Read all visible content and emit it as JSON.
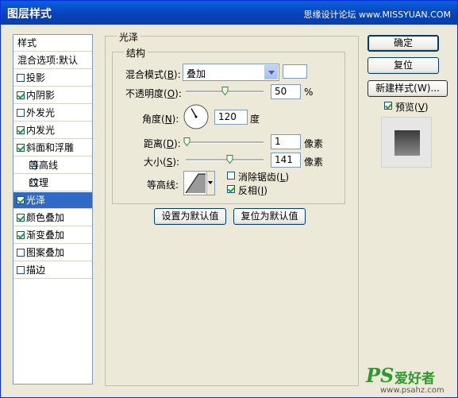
{
  "window": {
    "title": "图层样式",
    "watermark": "思缘设计论坛 www.MISSYUAN.COM"
  },
  "style_list": {
    "items": [
      {
        "label": "样式",
        "checkbox": false,
        "checked": false
      },
      {
        "label": "混合选项:默认",
        "checkbox": false,
        "checked": false
      },
      {
        "label": "投影",
        "checkbox": true,
        "checked": false
      },
      {
        "label": "内阴影",
        "checkbox": true,
        "checked": true
      },
      {
        "label": "外发光",
        "checkbox": true,
        "checked": false
      },
      {
        "label": "内发光",
        "checkbox": true,
        "checked": true
      },
      {
        "label": "斜面和浮雕",
        "checkbox": true,
        "checked": true
      },
      {
        "label": "等高线",
        "checkbox": true,
        "checked": false
      },
      {
        "label": "纹理",
        "checkbox": true,
        "checked": false
      },
      {
        "label": "光泽",
        "checkbox": true,
        "checked": true,
        "selected": true
      },
      {
        "label": "颜色叠加",
        "checkbox": true,
        "checked": true
      },
      {
        "label": "渐变叠加",
        "checkbox": true,
        "checked": true
      },
      {
        "label": "图案叠加",
        "checkbox": true,
        "checked": false
      },
      {
        "label": "描边",
        "checkbox": true,
        "checked": false
      }
    ]
  },
  "panel": {
    "group_title": "光泽",
    "sub_title": "结构",
    "blend_mode": {
      "label": "混合模式(",
      "key": "B",
      "suffix": "):",
      "value": "叠加"
    },
    "opacity": {
      "label": "不透明度(",
      "key": "O",
      "suffix": "):",
      "value": "50",
      "unit": "%",
      "level": 50
    },
    "angle": {
      "label": "角度(",
      "key": "N",
      "suffix": "):",
      "value": "120",
      "unit": "度"
    },
    "distance": {
      "label": "距离(",
      "key": "D",
      "suffix": "):",
      "value": "1",
      "unit": "像素",
      "level": 1
    },
    "size": {
      "label": "大小(",
      "key": "S",
      "suffix": "):",
      "value": "141",
      "unit": "像素",
      "level": 56
    },
    "contour": {
      "label": "等高线:"
    },
    "anti_alias": {
      "label_pre": "消除锯齿(",
      "key": "L",
      "suffix": ")",
      "checked": false
    },
    "invert": {
      "label_pre": "反相(",
      "key": "I",
      "suffix": ")",
      "checked": true
    },
    "make_default": "设置为默认值",
    "reset_default": "复位为默认值"
  },
  "buttons": {
    "ok": "确定",
    "reset": "复位",
    "new_style": "新建样式(W)...",
    "preview_pre": "预览(",
    "preview_key": "V",
    "preview_suffix": ")",
    "preview_checked": true
  },
  "footer_watermark": {
    "logo": "PS",
    "text": "爱好者",
    "url": "www.psahz.com"
  },
  "colors": {
    "accent": "#316ac5",
    "title_bar": "#0842b8",
    "checkmark": "#21a121"
  }
}
